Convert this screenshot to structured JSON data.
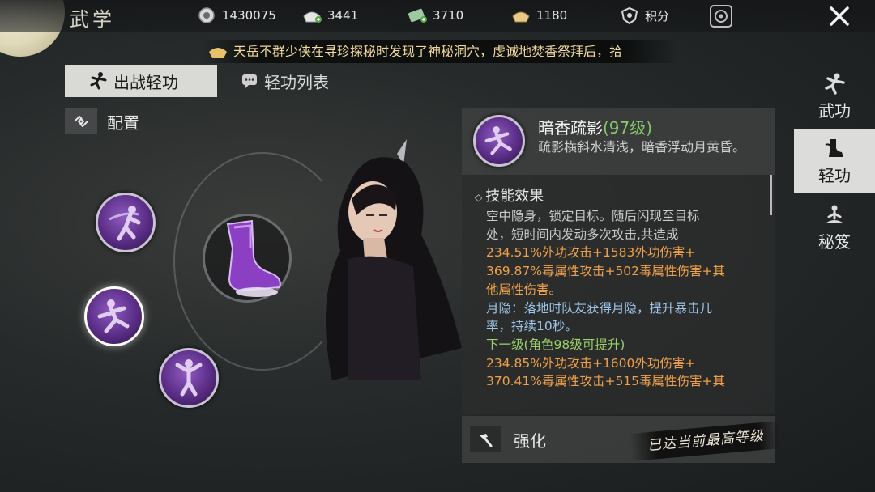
{
  "header": {
    "title": "武学",
    "resources": [
      {
        "icon": "coin-icon",
        "value": "1430075"
      },
      {
        "icon": "silver-ingot-add-icon",
        "value": "3441"
      },
      {
        "icon": "jade-ticket-add-icon",
        "value": "3710"
      },
      {
        "icon": "gold-ingot-icon",
        "value": "1180"
      }
    ],
    "points_label": "积分"
  },
  "ticker": {
    "text": "天岳不群少侠在寻珍探秘时发现了神秘洞穴，虔诚地焚香祭拜后，拾"
  },
  "tabs": [
    {
      "label": "出战轻功",
      "active": true
    },
    {
      "label": "轻功列表",
      "active": false
    }
  ],
  "config_label": "配置",
  "skill": {
    "name": "暗香疏影",
    "level": "(97级)",
    "description": "疏影横斜水清浅，暗香浮动月黄昏。",
    "effect_title": "技能效果",
    "effect_lines": [
      {
        "text": "空中隐身，锁定目标。随后闪现至目标",
        "style": "desc"
      },
      {
        "text": "处，短时间内发动多次攻击,共造成",
        "style": "desc"
      },
      {
        "text": "234.51%外功攻击+1583外功伤害+",
        "style": "orange"
      },
      {
        "text": "369.87%毒属性攻击+502毒属性伤害+其",
        "style": "orange"
      },
      {
        "text": "他属性伤害。",
        "style": "orange"
      },
      {
        "text": "月隐：落地时队友获得月隐，提升暴击几",
        "style": "blue"
      },
      {
        "text": "率，持续10秒。",
        "style": "blue"
      },
      {
        "text": "下一级(角色98级可提升)",
        "style": "green"
      },
      {
        "text": "234.85%外功攻击+1600外功伤害+",
        "style": "orange"
      },
      {
        "text": "370.41%毒属性攻击+515毒属性伤害+其",
        "style": "orange"
      }
    ],
    "enhance_label": "强化",
    "max_level_badge": "已达当前最高等级"
  },
  "sidenav": [
    {
      "label": "武功",
      "icon": "martial-pose-icon",
      "active": false
    },
    {
      "label": "轻功",
      "icon": "qinggong-boot-icon",
      "active": true
    },
    {
      "label": "秘笈",
      "icon": "meditation-icon",
      "active": false
    }
  ],
  "colors": {
    "accent_orange": "#f0a04a",
    "accent_green": "#9ad06a",
    "accent_blue": "#9ec6e8",
    "skill_purple": "#7a3fb0"
  }
}
